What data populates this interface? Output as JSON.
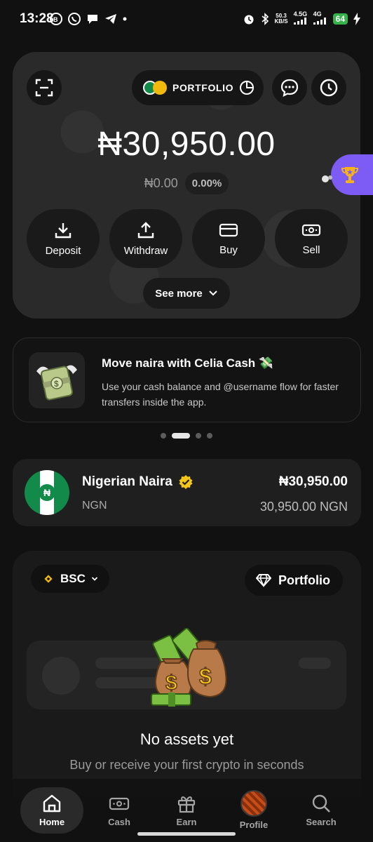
{
  "status_bar": {
    "time": "13:28",
    "speed_value": "50.3",
    "speed_unit": "KB/S",
    "net1": "4.5G",
    "net2": "4G",
    "battery": "64"
  },
  "hero": {
    "portfolio_label": "PORTFOLIO",
    "balance": "₦30,950.00",
    "change_amount": "₦0.00",
    "change_pct": "0.00%",
    "actions": [
      {
        "label": "Deposit",
        "icon": "download-icon"
      },
      {
        "label": "Withdraw",
        "icon": "upload-icon"
      },
      {
        "label": "Buy",
        "icon": "card-icon"
      },
      {
        "label": "Sell",
        "icon": "cash-icon"
      }
    ],
    "see_more": "See more"
  },
  "promo": {
    "title": "Move naira with Celia Cash 💸",
    "body": "Use your cash balance and @username flow for faster transfers inside the app.",
    "pages": 4,
    "active_page": 1
  },
  "currency": {
    "name": "Nigerian Naira",
    "code": "NGN",
    "amount": "₦30,950.00",
    "amount_sub": "30,950.00 NGN",
    "flag_symbol": "₦"
  },
  "assets": {
    "chain": "BSC",
    "portfolio_button": "Portfolio",
    "empty_title": "No assets yet",
    "empty_subtitle": "Buy or receive your first crypto in seconds"
  },
  "nav": {
    "items": [
      {
        "label": "Home",
        "icon": "home-icon",
        "active": true
      },
      {
        "label": "Cash",
        "icon": "cash-icon",
        "active": false
      },
      {
        "label": "Earn",
        "icon": "gift-icon",
        "active": false
      },
      {
        "label": "Profile",
        "icon": "avatar",
        "active": false
      },
      {
        "label": "Search",
        "icon": "search-icon",
        "active": false
      }
    ]
  },
  "colors": {
    "background": "#111111",
    "card": "#1f1f1f",
    "accent_purple": "#7c5cf5",
    "naira_green": "#118a4a",
    "verified_yellow": "#f5c518",
    "bnb_yellow": "#f0b90b"
  }
}
